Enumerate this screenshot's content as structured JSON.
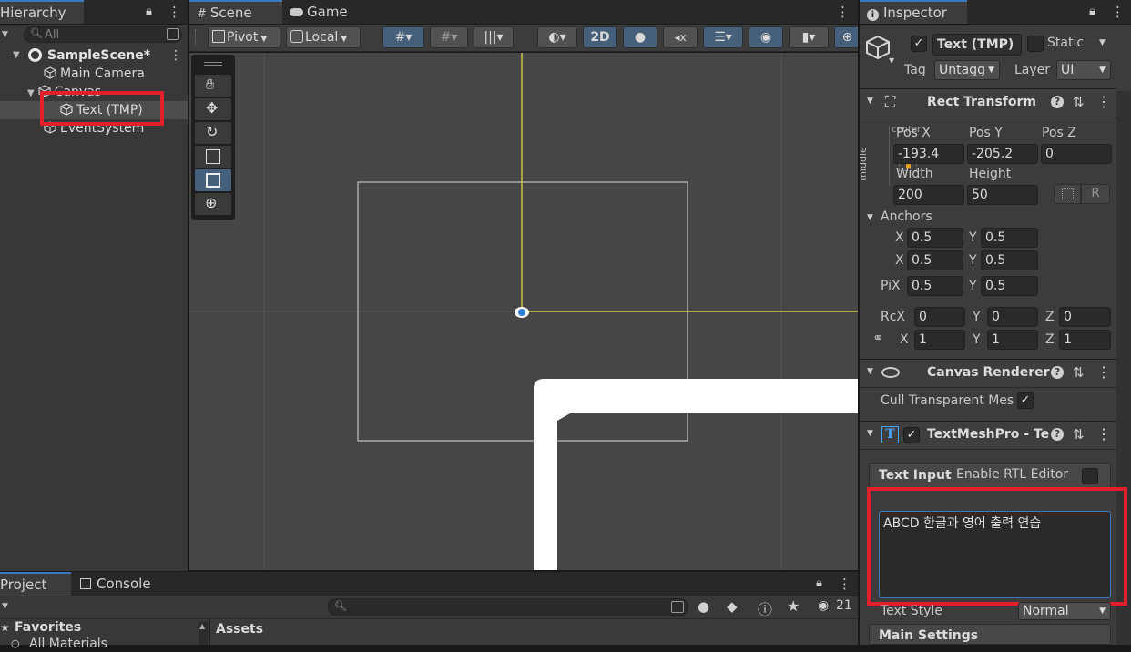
{
  "hierarchy": {
    "tab_label": "Hierarchy",
    "search_placeholder": "All",
    "scene_name": "SampleScene*",
    "items": [
      "Main Camera",
      "Canvas",
      "Text (TMP)",
      "EventSystem"
    ]
  },
  "scene_tabs": {
    "scene": "Scene",
    "game": "Game"
  },
  "scene_toolbar": {
    "pivot": "Pivot",
    "local": "Local",
    "mode_2d": "2D"
  },
  "inspector": {
    "tab_label": "Inspector",
    "object_name": "Text (TMP)",
    "static_label": "Static",
    "tag_label": "Tag",
    "tag_value": "Untagged",
    "layer_label": "Layer",
    "layer_value": "UI"
  },
  "rect_transform": {
    "title": "Rect Transform",
    "preset_top": "center",
    "preset_side": "middle",
    "pos_x_label": "Pos X",
    "pos_y_label": "Pos Y",
    "pos_z_label": "Pos Z",
    "pos_x": "-193.4",
    "pos_y": "-205.2",
    "pos_z": "0",
    "width_label": "Width",
    "height_label": "Height",
    "width": "200",
    "height": "50",
    "r_button": "R",
    "anchors_label": "Anchors",
    "anchor_min_label": "X",
    "anchor_min_x": "0.5",
    "anchor_min_y": "0.5",
    "anchor_max_label": "X",
    "anchor_max_x": "0.5",
    "anchor_max_y": "0.5",
    "pivot_label": "PiX",
    "pivot_x": "0.5",
    "pivot_y": "0.5",
    "rotation_label": "RcX",
    "rot_x": "0",
    "rot_y": "0",
    "rot_z": "0",
    "scale_x": "1",
    "scale_y": "1",
    "scale_z": "1",
    "y_label": "Y",
    "z_label": "Z",
    "x_label": "X"
  },
  "canvas_renderer": {
    "title": "Canvas Renderer",
    "cull_label": "Cull Transparent Mes"
  },
  "textmeshpro": {
    "title": "TextMeshPro - Te",
    "text_input_label": "Text Input",
    "rtl_label": "Enable RTL Editor",
    "text_value": "ABCD 한글과 영어 출력 연습",
    "text_style_label": "Text Style",
    "text_style_value": "Normal",
    "main_settings_label": "Main Settings"
  },
  "project": {
    "tab_label": "Project",
    "console_label": "Console",
    "favorites_label": "Favorites",
    "all_materials_label": "All Materials",
    "assets_label": "Assets",
    "hidden_count": "21"
  },
  "colors": {
    "accent": "#3a79bb",
    "highlight": "#e0202a",
    "selection": "#46607c"
  }
}
